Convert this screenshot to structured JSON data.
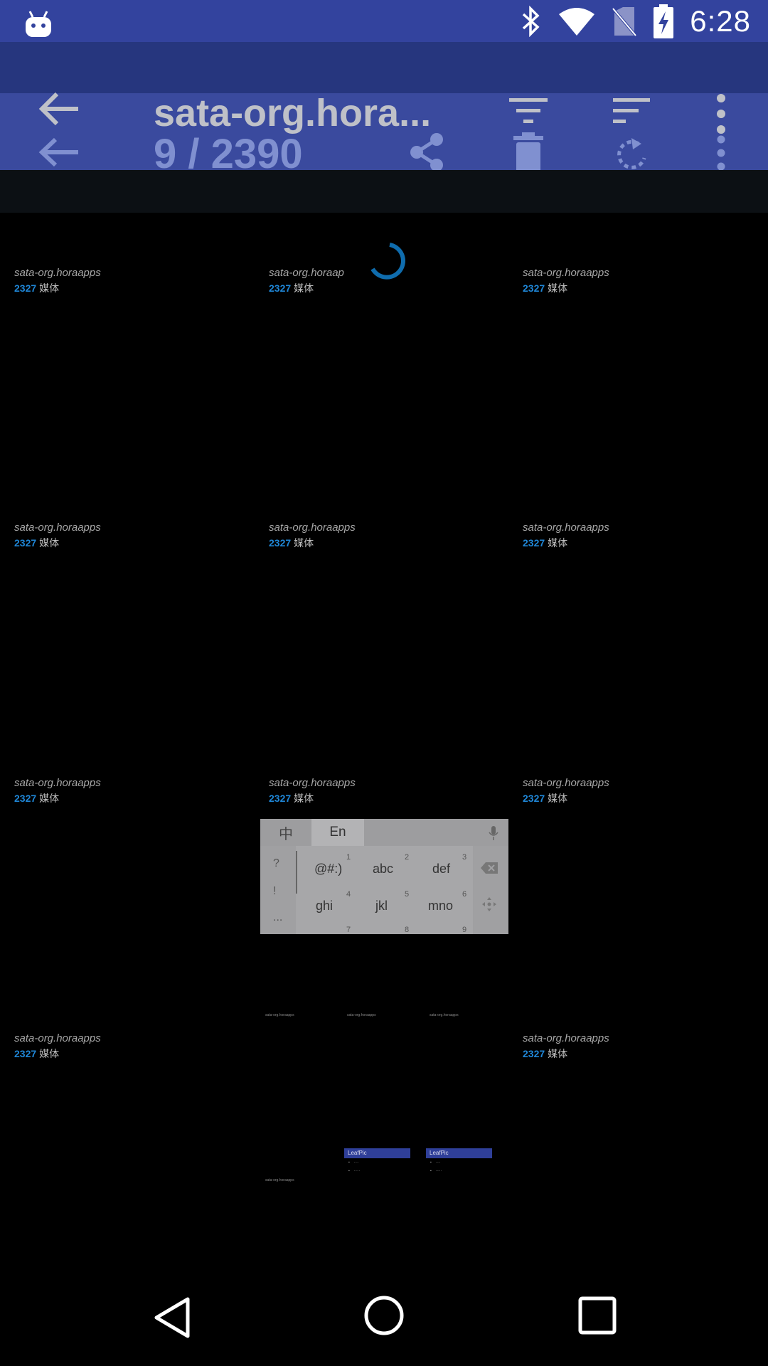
{
  "status_bar": {
    "time": "6:28",
    "icons": [
      "android-icon",
      "bluetooth-icon",
      "wifi-icon",
      "no-sim-icon",
      "battery-charging-icon"
    ]
  },
  "toolbar": {
    "title": "sata-org.hora...",
    "subtitle": "9 / 2390",
    "icons": [
      "back-arrow-icon",
      "filter-icon",
      "sort-icon",
      "more-vert-icon",
      "share-icon",
      "delete-icon",
      "rotate-icon"
    ]
  },
  "grid": {
    "item_name": "sata-org.horaapps",
    "truncated_name": "sata-org.horaap",
    "count": "2327",
    "count_suffix": "媒体",
    "count_color": "#1f86d6"
  },
  "keyboard": {
    "lang_zh": "中",
    "lang_en": "En",
    "side_symbols": [
      "?",
      "!",
      "..."
    ],
    "keys": [
      "@#:)",
      "abc",
      "def",
      "ghi",
      "jkl",
      "mno"
    ],
    "numbers": [
      "1",
      "2",
      "3",
      "4",
      "5",
      "6",
      "7",
      "8",
      "9"
    ]
  },
  "thumbnails": {
    "app_name": "LeafPic"
  },
  "colors": {
    "status_bar": "#33439e",
    "toolbar": "#3a4a9e",
    "accent": "#1f86d6",
    "background": "#000000"
  }
}
